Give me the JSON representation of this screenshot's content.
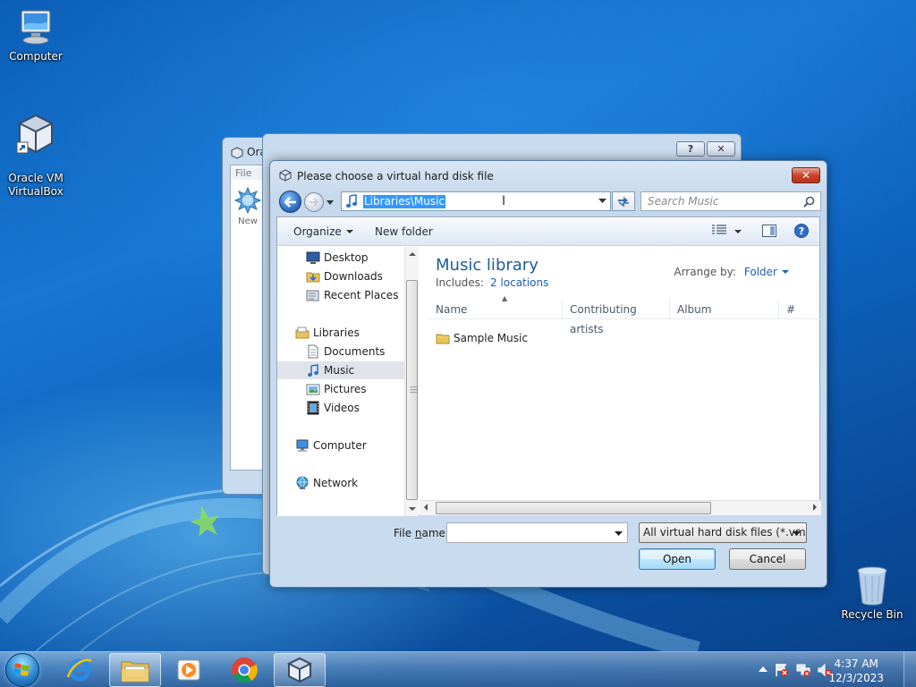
{
  "desktop": {
    "icons": [
      {
        "label": "Computer"
      },
      {
        "label": "Oracle VM\nVirtualBox"
      },
      {
        "label": "Recycle Bin"
      }
    ]
  },
  "back_window": {
    "title": "Oracle VM VirtualBox Manager",
    "menu_file": "File",
    "new_label": "New"
  },
  "dialog": {
    "title": "Please choose a virtual hard disk file",
    "close_label": "✕",
    "address": {
      "path": "Libraries\\Music"
    },
    "search": {
      "placeholder": "Search Music"
    },
    "toolbar": {
      "organize": "Organize",
      "new_folder": "New folder"
    },
    "nav": {
      "favorites": [
        "Desktop",
        "Downloads",
        "Recent Places"
      ],
      "libraries_header": "Libraries",
      "libraries": [
        "Documents",
        "Music",
        "Pictures",
        "Videos"
      ],
      "computer": "Computer",
      "network": "Network",
      "selected": "Music"
    },
    "library": {
      "title": "Music library",
      "includes_label": "Includes:",
      "includes_link": "2 locations",
      "arrange_label": "Arrange by:",
      "arrange_value": "Folder"
    },
    "columns": [
      "Name",
      "Contributing artists",
      "Album",
      "#"
    ],
    "files": [
      {
        "name": "Sample Music"
      }
    ],
    "file_name": {
      "label_pre": "File ",
      "label_u": "n",
      "label_post": "ame:",
      "value": ""
    },
    "file_type": "All virtual hard disk files (*.vmd",
    "buttons": {
      "open": "Open",
      "cancel": "Cancel"
    }
  },
  "back_dialog": {
    "help": "?",
    "close": "✕"
  },
  "taskbar": {
    "clock_time": "4:37 AM",
    "clock_date": "12/3/2023"
  }
}
